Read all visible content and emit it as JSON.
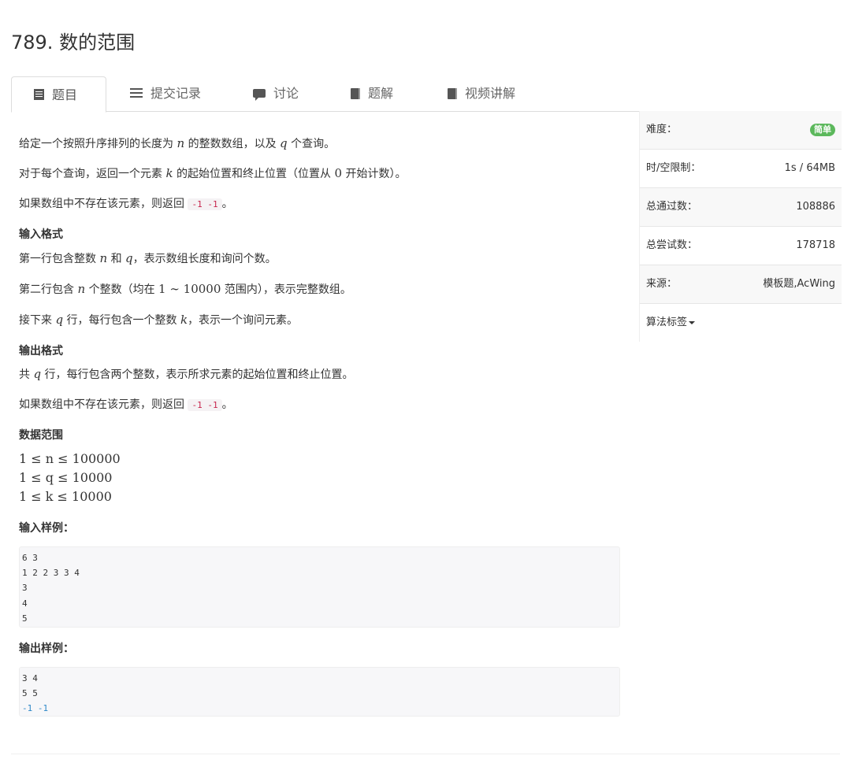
{
  "problem": {
    "title": "789. 数的范围"
  },
  "tabs": [
    {
      "label": "题目",
      "icon": "document-icon"
    },
    {
      "label": "提交记录",
      "icon": "list-icon"
    },
    {
      "label": "讨论",
      "icon": "comment-icon"
    },
    {
      "label": "题解",
      "icon": "book-icon"
    },
    {
      "label": "视频讲解",
      "icon": "book-icon"
    }
  ],
  "description": {
    "p1_a": "给定一个按照升序排列的长度为 ",
    "p1_n": "n",
    "p1_b": " 的整数数组，以及 ",
    "p1_q": "q",
    "p1_c": " 个查询。",
    "p2_a": "对于每个查询，返回一个元素 ",
    "p2_k": "k",
    "p2_b": " 的起始位置和终止位置（位置从 ",
    "p2_0": "0",
    "p2_c": " 开始计数）。",
    "p3_a": "如果数组中不存在该元素，则返回 ",
    "p3_code": "-1 -1",
    "p3_b": "。"
  },
  "input_format": {
    "heading": "输入格式",
    "l1_a": "第一行包含整数 ",
    "l1_n": "n",
    "l1_b": " 和 ",
    "l1_q": "q",
    "l1_c": "，表示数组长度和询问个数。",
    "l2_a": "第二行包含 ",
    "l2_n": "n",
    "l2_b": " 个整数（均在 ",
    "l2_range": "1 ∼ 10000",
    "l2_c": " 范围内），表示完整数组。",
    "l3_a": "接下来 ",
    "l3_q": "q",
    "l3_b": " 行，每行包含一个整数 ",
    "l3_k": "k",
    "l3_c": "，表示一个询问元素。"
  },
  "output_format": {
    "heading": "输出格式",
    "l1_a": "共 ",
    "l1_q": "q",
    "l1_b": " 行，每行包含两个整数，表示所求元素的起始位置和终止位置。",
    "l2_a": "如果数组中不存在该元素，则返回 ",
    "l2_code": "-1 -1",
    "l2_b": "。"
  },
  "data_range": {
    "heading": "数据范围",
    "r1": "1 ≤ n ≤ 100000",
    "r2": "1 ≤ q ≤ 10000",
    "r3": "1 ≤ k ≤ 10000"
  },
  "sample_input": {
    "heading": "输入样例：",
    "lines": [
      "6 3",
      "1 2 2 3 3 4",
      "3",
      "4",
      "5"
    ]
  },
  "sample_output": {
    "heading": "输出样例：",
    "lines": [
      "3 4",
      "5 5",
      "-1 -1"
    ]
  },
  "sidebar": {
    "difficulty_label": "难度：",
    "difficulty_value": "简单",
    "limit_label": "时/空限制：",
    "limit_value": "1s / 64MB",
    "accepted_label": "总通过数：",
    "accepted_value": "108886",
    "attempts_label": "总尝试数：",
    "attempts_value": "178718",
    "source_label": "来源：",
    "source_value": "模板题,AcWing",
    "tags_label": "算法标签"
  },
  "colors": {
    "easy_badge": "#5cb85c",
    "code_text": "#c7254e",
    "negative_output": "#2f88c8"
  }
}
